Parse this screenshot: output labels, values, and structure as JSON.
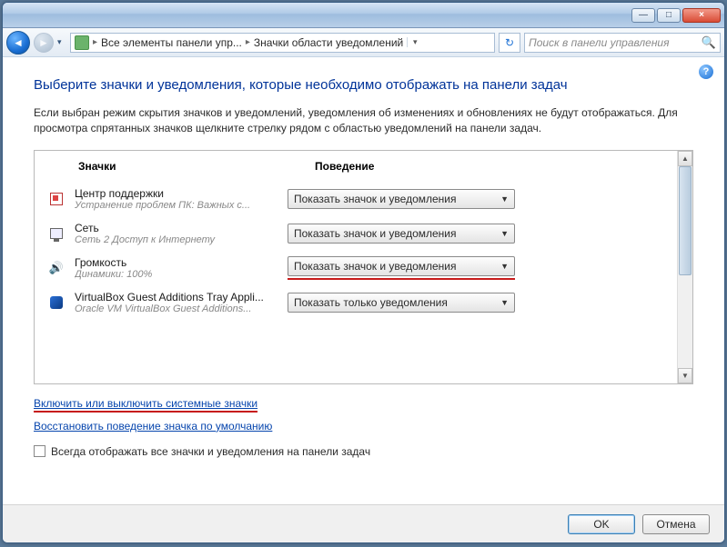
{
  "window": {
    "minimize": "—",
    "maximize": "□",
    "close": "×"
  },
  "addressbar": {
    "crumb1": "Все элементы панели упр...",
    "crumb2": "Значки области уведомлений",
    "search_placeholder": "Поиск в панели управления"
  },
  "page": {
    "title": "Выберите значки и уведомления, которые необходимо отображать на панели задач",
    "desc": "Если выбран режим скрытия значков и уведомлений, уведомления об изменениях и обновлениях не будут отображаться. Для просмотра спрятанных значков щелкните стрелку рядом с областью уведомлений на панели задач."
  },
  "table": {
    "header_icons": "Значки",
    "header_behavior": "Поведение",
    "rows": [
      {
        "name": "Центр поддержки",
        "sub": "Устранение проблем ПК: Важных с...",
        "behavior": "Показать значок и уведомления",
        "highlight": false
      },
      {
        "name": "Сеть",
        "sub": "Сеть 2 Доступ к Интернету",
        "behavior": "Показать значок и уведомления",
        "highlight": false
      },
      {
        "name": "Громкость",
        "sub": "Динамики: 100%",
        "behavior": "Показать значок и уведомления",
        "highlight": true
      },
      {
        "name": "VirtualBox Guest Additions Tray Appli...",
        "sub": "Oracle VM VirtualBox Guest Additions...",
        "behavior": "Показать только уведомления",
        "highlight": false
      }
    ]
  },
  "links": {
    "system_icons": "Включить или выключить системные значки",
    "restore_defaults": "Восстановить поведение значка по умолчанию"
  },
  "checkbox": {
    "label": "Всегда отображать все значки и уведомления на панели задач",
    "checked": false
  },
  "footer": {
    "ok": "OK",
    "cancel": "Отмена"
  }
}
